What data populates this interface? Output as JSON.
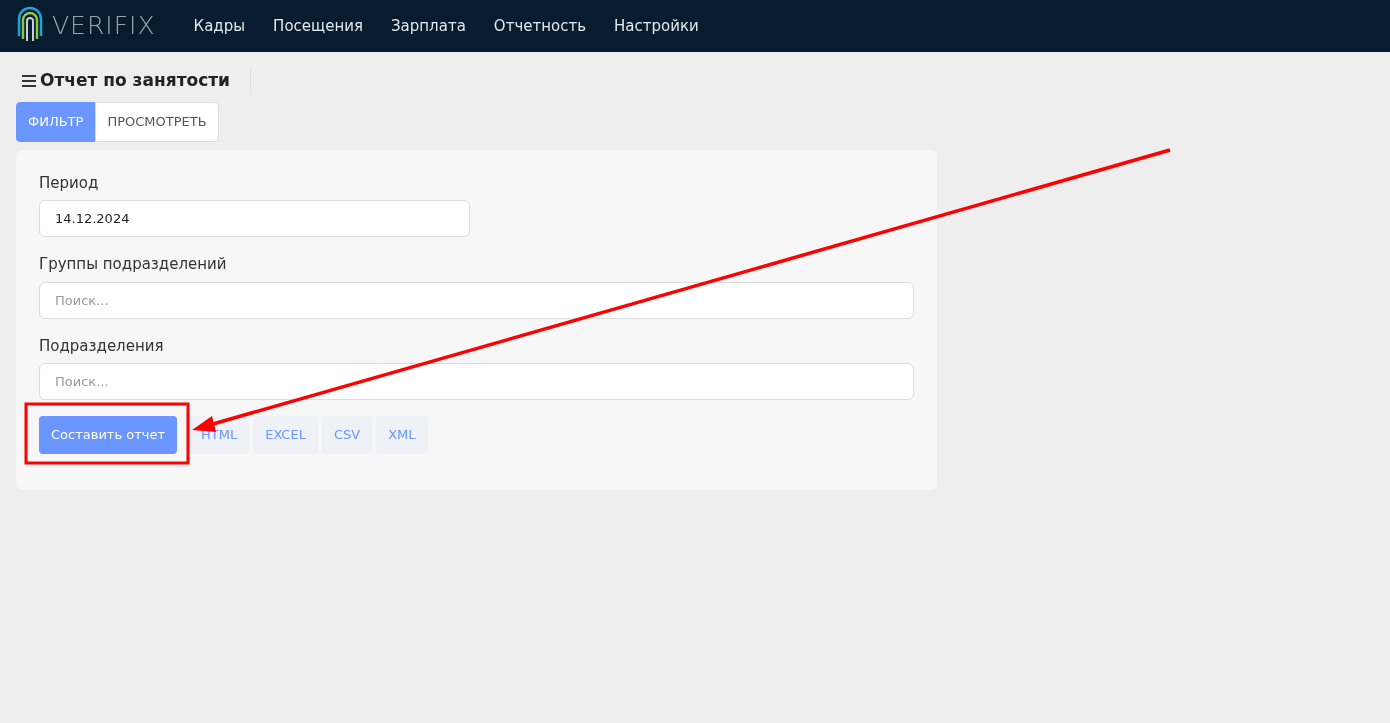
{
  "brand": {
    "name": "VERIFIX"
  },
  "nav": [
    {
      "label": "Кадры"
    },
    {
      "label": "Посещения"
    },
    {
      "label": "Зарплата"
    },
    {
      "label": "Отчетность"
    },
    {
      "label": "Настройки"
    }
  ],
  "page_title": "Отчет по занятости",
  "tabs": [
    {
      "label": "ФИЛЬТР",
      "selected": true
    },
    {
      "label": "ПРОСМОТРЕТЬ",
      "selected": false
    }
  ],
  "fields": [
    {
      "label": "Период",
      "value": "14.12.2024",
      "kind": "date"
    },
    {
      "label": "Группы подразделений",
      "placeholder": "Поиск...",
      "kind": "search"
    },
    {
      "label": "Подразделения",
      "placeholder": "Поиск...",
      "kind": "search"
    }
  ],
  "buttons": [
    {
      "label": "Составить отчет",
      "kind": "primary",
      "highlighted": true
    },
    {
      "label": "HTML",
      "kind": "format",
      "highlighted": false
    },
    {
      "label": "EXCEL",
      "kind": "format",
      "highlighted": false
    },
    {
      "label": "CSV",
      "kind": "format",
      "highlighted": false
    },
    {
      "label": "XML",
      "kind": "format",
      "highlighted": false
    }
  ]
}
